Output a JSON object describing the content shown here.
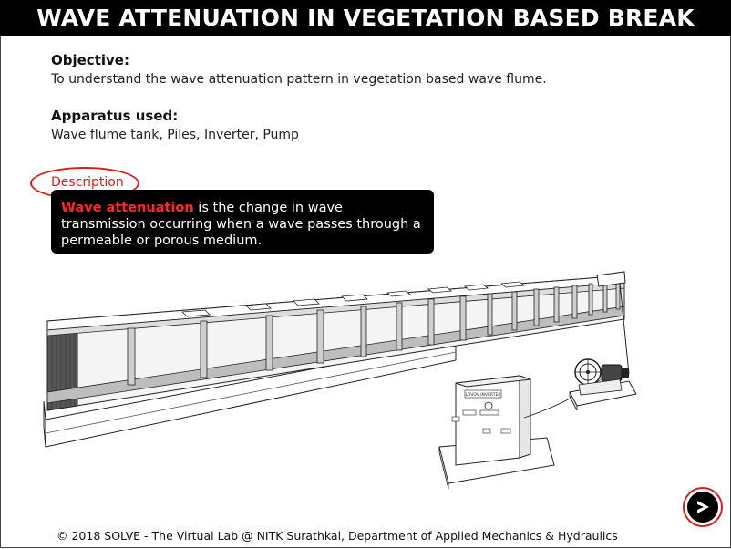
{
  "title": "WAVE ATTENUATION IN VEGETATION BASED BREAK",
  "objective": {
    "heading": "Objective:",
    "text": "To understand the wave attenuation pattern in vegetation based wave flume."
  },
  "apparatus": {
    "heading": "Apparatus used:",
    "text": "Wave flume tank, Piles, Inverter, Pump"
  },
  "description": {
    "link_label": "Description",
    "tooltip_highlight": "Wave attenuation",
    "tooltip_rest": " is the change in wave transmission occurring when a wave passes through a permeable or porous medium."
  },
  "illustration": {
    "inverter_label": "LOVOV INVERTER"
  },
  "footer": "© 2018 SOLVE - The Virtual Lab @ NITK Surathkal, Department of Applied Mechanics & Hydraulics",
  "next_button": {
    "icon": "arrow-right-icon"
  },
  "colors": {
    "accent_red": "#d42020",
    "highlight_red": "#ff2a2a",
    "title_bg": "#000000"
  }
}
